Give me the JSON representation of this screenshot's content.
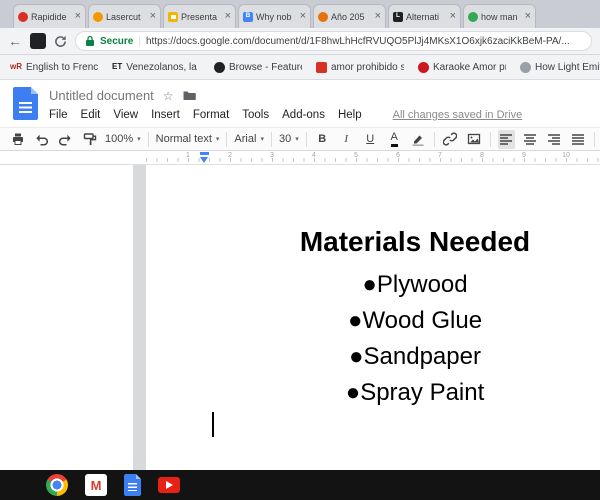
{
  "colors": {
    "secure_green": "#0b8043",
    "docs_blue": "#3d7ef0",
    "ruler_marker_blue": "#4285f4"
  },
  "browser": {
    "close_glyph": "×",
    "tabs": [
      {
        "title": "Rapidide",
        "favicon": {
          "color": "#d93025",
          "glyph": ""
        }
      },
      {
        "title": "Lasercut",
        "favicon": {
          "color": "#f29900",
          "glyph": ""
        }
      },
      {
        "title": "Presenta",
        "favicon": {
          "color": "#f4b400",
          "glyph": ""
        }
      },
      {
        "title": "Why nob",
        "favicon": {
          "color": "#4285f4",
          "glyph": "B"
        }
      },
      {
        "title": "Año 205",
        "favicon": {
          "color": "#e8710a",
          "glyph": ""
        }
      },
      {
        "title": "Alternati",
        "favicon": {
          "color": "#202124",
          "glyph": "L"
        }
      },
      {
        "title": "how man",
        "favicon": {
          "color": "#34a853",
          "glyph": ""
        }
      }
    ],
    "nav": {
      "back_glyph": "←",
      "secure_label": "Secure",
      "url": "https://docs.google.com/document/d/1F8hwLhHcfRVUQO5PlJj4MKsX1O6xjk6zaciKkBeM-PA/..."
    },
    "bookmarks": [
      {
        "label": "English to French,",
        "glyph": "wR",
        "color": "#b3261e"
      },
      {
        "label": "Venezolanos, la m",
        "glyph": "ET",
        "color": "#1a1a1a"
      },
      {
        "label": "Browse - Featured",
        "glyph": "",
        "color": "#222222"
      },
      {
        "label": "amor prohibido se",
        "glyph": "",
        "color": "#d93025"
      },
      {
        "label": "Karaoke Amor pro",
        "glyph": "",
        "color": "#cc181e"
      },
      {
        "label": "How Light Emittin",
        "glyph": "",
        "color": "#9aa0a6"
      }
    ]
  },
  "docs": {
    "doc_title": "Untitled document",
    "star_glyph": "☆",
    "menu": [
      "File",
      "Edit",
      "View",
      "Insert",
      "Format",
      "Tools",
      "Add-ons",
      "Help"
    ],
    "save_status": "All changes saved in Drive",
    "toolbar": {
      "zoom": "100%",
      "styles": "Normal text",
      "font": "Arial",
      "font_size": "30",
      "bold": "B",
      "italic": "I",
      "underline": "U",
      "text_color": "A",
      "caret": "▾"
    },
    "ruler_numbers": [
      "1",
      "2",
      "3",
      "4",
      "5",
      "6",
      "7",
      "8",
      "9",
      "10"
    ],
    "document": {
      "heading": "Materials Needed",
      "bullet_glyph": "●",
      "bullets": [
        "Plywood",
        "Wood Glue",
        "Sandpaper",
        "Spray Paint"
      ]
    }
  },
  "shelf": {
    "gmail_glyph": "M"
  }
}
